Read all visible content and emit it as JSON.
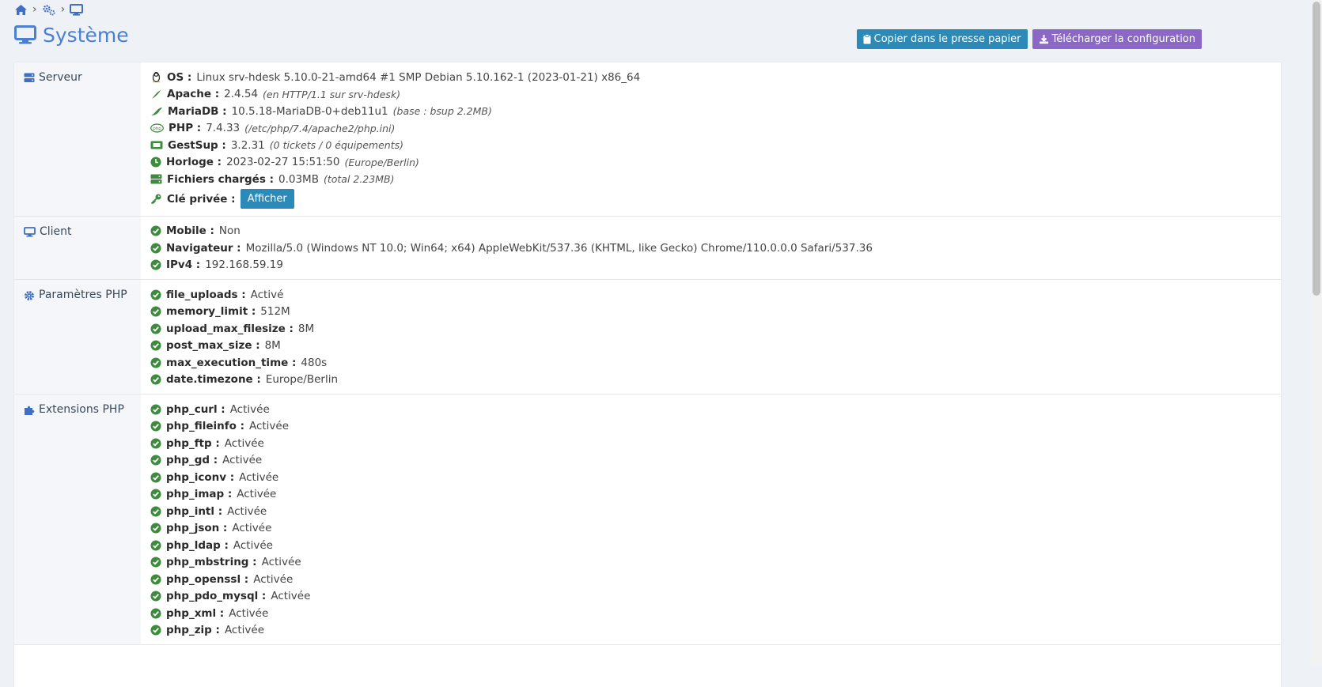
{
  "page_title": "Système",
  "actions": {
    "copy_label": "Copier dans le presse papier",
    "download_label": "Télécharger la configuration"
  },
  "server": {
    "title": "Serveur",
    "rows": [
      {
        "label": "OS :",
        "value": "Linux srv-hdesk 5.10.0-21-amd64 #1 SMP Debian 5.10.162-1 (2023-01-21) x86_64",
        "note": "",
        "icon": "linux-icon"
      },
      {
        "label": "Apache :",
        "value": "2.4.54",
        "note": "(en HTTP/1.1 sur srv-hdesk)",
        "icon": "apache-feather-icon"
      },
      {
        "label": "MariaDB :",
        "value": "10.5.18-MariaDB-0+deb11u1",
        "note": "(base : bsup 2.2MB)",
        "icon": "mariadb-seal-icon"
      },
      {
        "label": "PHP :",
        "value": "7.4.33",
        "note": "(/etc/php/7.4/apache2/php.ini)",
        "icon": "php-icon"
      },
      {
        "label": "GestSup :",
        "value": "3.2.31",
        "note": "(0 tickets / 0 équipements)",
        "icon": "ticket-icon"
      },
      {
        "label": "Horloge :",
        "value": "2023-02-27 15:51:50",
        "note": "(Europe/Berlin)",
        "icon": "clock-icon"
      },
      {
        "label": "Fichiers chargés :",
        "value": "0.03MB",
        "note": "(total 2.23MB)",
        "icon": "hdd-icon"
      }
    ],
    "private_key_label": "Clé privée :",
    "show_button": "Afficher"
  },
  "client": {
    "title": "Client",
    "rows": [
      {
        "label": "Mobile :",
        "value": "Non"
      },
      {
        "label": "Navigateur :",
        "value": "Mozilla/5.0 (Windows NT 10.0; Win64; x64) AppleWebKit/537.36 (KHTML, like Gecko) Chrome/110.0.0.0 Safari/537.36"
      },
      {
        "label": "IPv4 :",
        "value": "192.168.59.19"
      }
    ]
  },
  "php_params": {
    "title": "Paramètres PHP",
    "rows": [
      {
        "label": "file_uploads :",
        "value": "Activé"
      },
      {
        "label": "memory_limit :",
        "value": "512M"
      },
      {
        "label": "upload_max_filesize :",
        "value": "8M"
      },
      {
        "label": "post_max_size :",
        "value": "8M"
      },
      {
        "label": "max_execution_time :",
        "value": "480s"
      },
      {
        "label": "date.timezone :",
        "value": "Europe/Berlin"
      }
    ]
  },
  "php_ext": {
    "title": "Extensions PHP",
    "rows": [
      {
        "label": "php_curl :",
        "value": "Activée"
      },
      {
        "label": "php_fileinfo :",
        "value": "Activée"
      },
      {
        "label": "php_ftp :",
        "value": "Activée"
      },
      {
        "label": "php_gd :",
        "value": "Activée"
      },
      {
        "label": "php_iconv :",
        "value": "Activée"
      },
      {
        "label": "php_imap :",
        "value": "Activée"
      },
      {
        "label": "php_intl :",
        "value": "Activée"
      },
      {
        "label": "php_json :",
        "value": "Activée"
      },
      {
        "label": "php_ldap :",
        "value": "Activée"
      },
      {
        "label": "php_mbstring :",
        "value": "Activée"
      },
      {
        "label": "php_openssl :",
        "value": "Activée"
      },
      {
        "label": "php_pdo_mysql :",
        "value": "Activée"
      },
      {
        "label": "php_xml :",
        "value": "Activée"
      },
      {
        "label": "php_zip :",
        "value": "Activée"
      }
    ]
  },
  "colors": {
    "accent": "#4a7fd1",
    "ok": "#3d8b3d",
    "button_blue": "#2b8ab8",
    "button_purple": "#8b67c6"
  }
}
